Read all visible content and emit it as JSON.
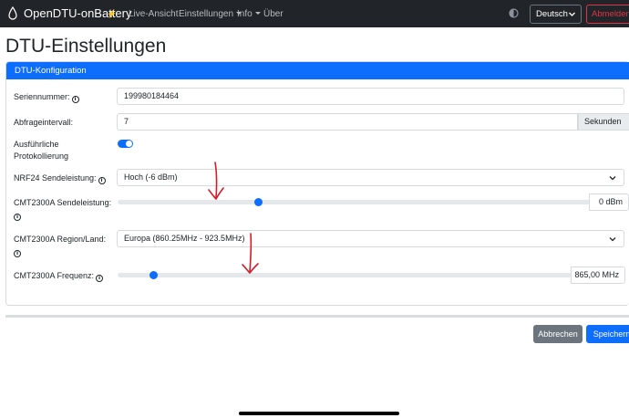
{
  "navbar": {
    "brand": "OpenDTU-onBattery",
    "brand_bolt": "⚡",
    "links": {
      "live": "Live-Ansicht",
      "settings": "Einstellungen",
      "info": "Info",
      "about": "Über"
    },
    "language": "Deutsch",
    "logout": "Abmelden"
  },
  "page": {
    "title": "DTU-Einstellungen"
  },
  "card": {
    "header": "DTU-Konfiguration",
    "serial": {
      "label": "Seriennummer:",
      "value": "199980184464"
    },
    "interval": {
      "label": "Abfrageintervall:",
      "value": "7",
      "unit": "Sekunden"
    },
    "verbose": {
      "label_line1": "Ausführliche",
      "label_line2": "Protokollierung",
      "enabled": true
    },
    "nrf_power": {
      "label": "NRF24 Sendeleistung:",
      "value": "Hoch (-6 dBm)"
    },
    "cmt_power": {
      "label": "CMT2300A Sendeleistung:",
      "value": "0 dBm",
      "slider_fraction": 0.3
    },
    "cmt_region": {
      "label": "CMT2300A Region/Land:",
      "value": "Europa (860.25MHz - 923.5MHz)"
    },
    "cmt_freq": {
      "label": "CMT2300A Frequenz:",
      "value": "865,00 MHz",
      "slider_fraction": 0.08
    }
  },
  "buttons": {
    "cancel": "Abbrechen",
    "save": "Speichern"
  },
  "colors": {
    "primary": "#0d6efd",
    "navbar": "#212529",
    "secondary": "#6c757d",
    "danger": "#dc3545",
    "annotation": "#d41c2c"
  },
  "icons": {
    "brand": "water-drop-icon",
    "theme": "half-circle-theme-icon",
    "info": "info-circle-icon",
    "chevron": "chevron-down-icon"
  }
}
